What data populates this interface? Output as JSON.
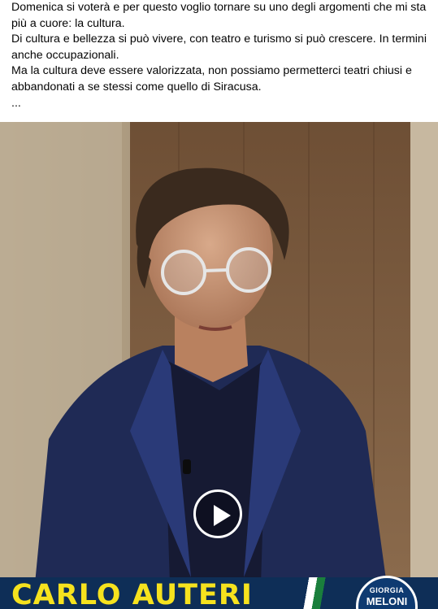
{
  "post": {
    "paragraphs": [
      "Domenica si voterà e per questo voglio tornare su uno degli argomenti che mi sta più a cuore: la cultura.",
      "Di cultura e bellezza si può vivere, con teatro e turismo si può crescere. In termini anche occupazionali.",
      "Ma la cultura deve essere valorizzata, non possiamo permetterci teatri chiusi e abbandonati a se stessi come quello di Siracusa.",
      "..."
    ]
  },
  "video": {
    "banner_name": "CARLO AUTERI",
    "logo_top": "GIORGIA",
    "logo_main": "MELONI",
    "play_icon": "play-icon"
  },
  "colors": {
    "banner": "#0e2e57",
    "banner_text": "#f6e21e",
    "logo_bg": "#0e3a71"
  }
}
